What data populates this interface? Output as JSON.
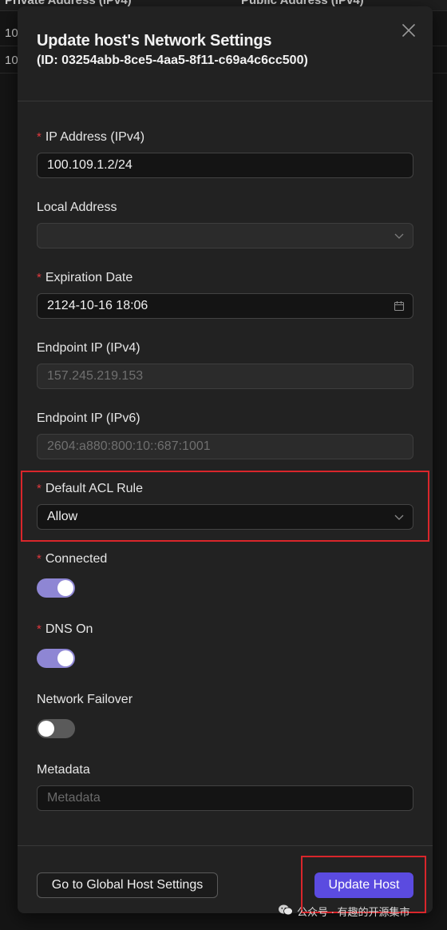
{
  "background_table": {
    "headers": [
      "Private Address (IPv4)",
      "Public Address (IPv4)"
    ],
    "rows": [
      "10",
      "10"
    ]
  },
  "modal": {
    "title": "Update host's Network Settings",
    "subtitle": "(ID: 03254abb-8ce5-4aa5-8f11-c69a4c6cc500)",
    "close_icon": "close-icon"
  },
  "fields": {
    "ip_address": {
      "label": "IP Address (IPv4)",
      "required": "*",
      "value": "100.109.1.2/24"
    },
    "local_address": {
      "label": "Local Address",
      "value": "",
      "icon": "chevron-down-icon"
    },
    "expiration_date": {
      "label": "Expiration Date",
      "required": "*",
      "value": "2124-10-16 18:06",
      "icon": "calendar-icon"
    },
    "endpoint_ipv4": {
      "label": "Endpoint IP (IPv4)",
      "value": "157.245.219.153"
    },
    "endpoint_ipv6": {
      "label": "Endpoint IP (IPv6)",
      "value": "2604:a880:800:10::687:1001"
    },
    "default_acl_rule": {
      "label": "Default ACL Rule",
      "required": "*",
      "value": "Allow",
      "icon": "chevron-down-icon"
    },
    "connected": {
      "label": "Connected",
      "required": "*",
      "on": true
    },
    "dns_on": {
      "label": "DNS On",
      "required": "*",
      "on": true
    },
    "network_failover": {
      "label": "Network Failover",
      "on": false
    },
    "metadata": {
      "label": "Metadata",
      "placeholder": "Metadata"
    }
  },
  "footer": {
    "global_settings_label": "Go to Global Host Settings",
    "update_label": "Update Host"
  },
  "watermark": {
    "text": "公众号 · 有趣的开源集市",
    "icon": "wechat-icon"
  },
  "colors": {
    "primary": "#5b4be0",
    "toggle_on": "#8e86d4",
    "required": "#e0393e",
    "highlight": "#d9262b"
  }
}
